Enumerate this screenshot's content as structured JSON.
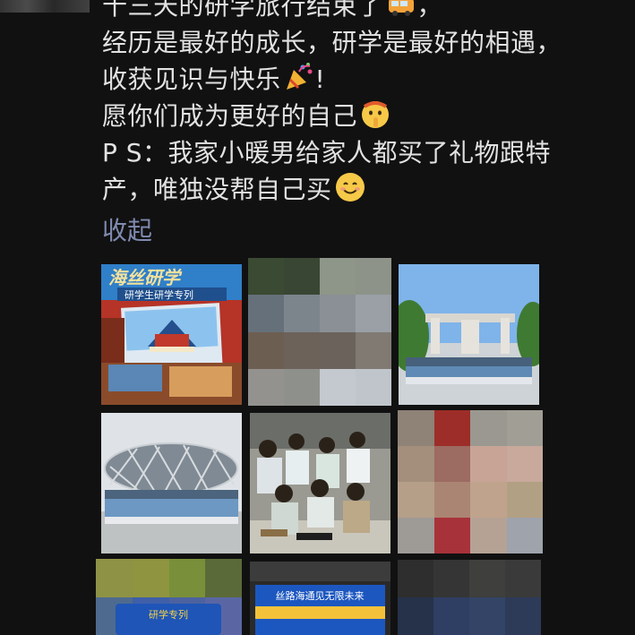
{
  "post": {
    "line1": "十三天的研学旅行结束了",
    "line2": "经历是最好的成长，研学是最好的相遇，",
    "line3": "收获见识与快乐",
    "line3_end": "!",
    "line4": "愿你们成为更好的自己",
    "line5": "P S：我家小暖男给家人都买了礼物跟特",
    "line6": "产，唯独没帮自己买",
    "line1_end": "，",
    "emojis": [
      "bus-icon",
      "party-popper-icon",
      "shushing-face-icon",
      "smiling-face-icon"
    ]
  },
  "collapse_label": "收起",
  "photos": [
    {
      "name": "photo-1-poster",
      "overlay_text": "研学生研学专列"
    },
    {
      "name": "photo-2-blurred"
    },
    {
      "name": "photo-3-gate-group"
    },
    {
      "name": "photo-4-birds-nest-group"
    },
    {
      "name": "photo-5-students-sitting"
    },
    {
      "name": "photo-6-blurred"
    },
    {
      "name": "photo-7-banner",
      "overlay_text": "研学专列"
    },
    {
      "name": "photo-8-banner",
      "overlay_text": "丝路海通见无限未来"
    },
    {
      "name": "photo-9-blurred"
    }
  ],
  "colors": {
    "background": "#111111",
    "text": "#e2e2e2",
    "link": "#7f8bb0"
  }
}
